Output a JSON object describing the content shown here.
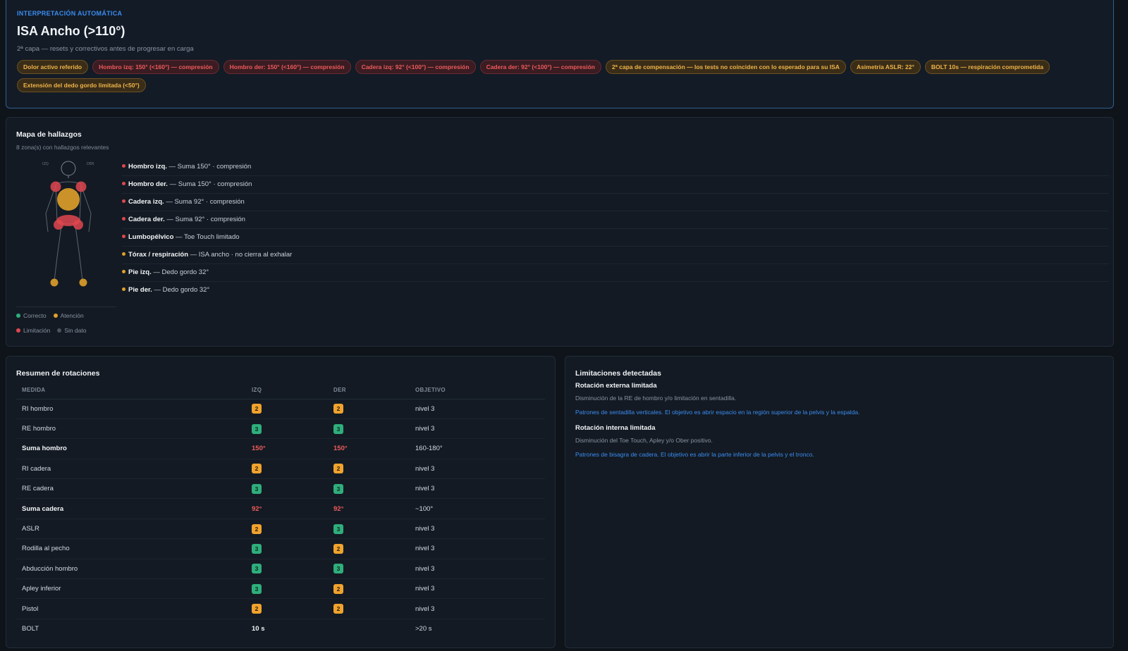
{
  "header": {
    "kicker": "INTERPRETACIÓN AUTOMÁTICA",
    "title": "ISA Ancho (>110°)",
    "subtitle": "2ª capa — resets y correctivos antes de progresar en carga",
    "chips": [
      {
        "text": "Dolor activo referido",
        "tone": "amber"
      },
      {
        "text": "Hombro izq: 150° (<160°) — compresión",
        "tone": "red"
      },
      {
        "text": "Hombro der: 150° (<160°) — compresión",
        "tone": "red"
      },
      {
        "text": "Cadera izq: 92° (<100°) — compresión",
        "tone": "red"
      },
      {
        "text": "Cadera der: 92° (<100°) — compresión",
        "tone": "red"
      },
      {
        "text": "2ª capa de compensación — los tests no coinciden con lo esperado para su ISA",
        "tone": "amber"
      },
      {
        "text": "Asimetría ASLR: 22°",
        "tone": "amber"
      },
      {
        "text": "BOLT 10s — respiración comprometida",
        "tone": "amber"
      },
      {
        "text": "Extensión del dedo gordo limitada (<50°)",
        "tone": "amber"
      }
    ]
  },
  "map": {
    "title": "Mapa de hallazgos",
    "subtitle": "8 zona(s) con hallazgos relevantes",
    "fig_left_label": "IZQ",
    "fig_right_label": "DER",
    "findings": [
      {
        "zone": "Hombro izq.",
        "detail": " — Suma 150° · compresión",
        "tone": "red"
      },
      {
        "zone": "Hombro der.",
        "detail": " — Suma 150° · compresión",
        "tone": "red"
      },
      {
        "zone": "Cadera izq.",
        "detail": " — Suma 92° · compresión",
        "tone": "red"
      },
      {
        "zone": "Cadera der.",
        "detail": " — Suma 92° · compresión",
        "tone": "red"
      },
      {
        "zone": "Lumbopélvico",
        "detail": " — Toe Touch limitado",
        "tone": "red"
      },
      {
        "zone": "Tórax / respiración",
        "detail": " — ISA ancho · no cierra al exhalar",
        "tone": "amber"
      },
      {
        "zone": "Pie izq.",
        "detail": " — Dedo gordo 32°",
        "tone": "amber"
      },
      {
        "zone": "Pie der.",
        "detail": " — Dedo gordo 32°",
        "tone": "amber"
      }
    ],
    "legend": {
      "ok": "Correcto",
      "attention": "Atención",
      "limit": "Limitación",
      "nodata": "Sin dato"
    }
  },
  "rotations": {
    "title": "Resumen de rotaciones",
    "headers": {
      "measure": "MEDIDA",
      "left": "IZQ",
      "right": "DER",
      "target": "OBJETIVO"
    },
    "rows": [
      {
        "measure": "RI hombro",
        "left": "2",
        "right": "2",
        "target": "nivel 3",
        "kind": "badge"
      },
      {
        "measure": "RE hombro",
        "left": "3",
        "right": "3",
        "target": "nivel 3",
        "kind": "badge"
      },
      {
        "measure": "Suma hombro",
        "left": "150°",
        "right": "150°",
        "target": "160-180°",
        "kind": "sum"
      },
      {
        "measure": "RI cadera",
        "left": "2",
        "right": "2",
        "target": "nivel 3",
        "kind": "badge"
      },
      {
        "measure": "RE cadera",
        "left": "3",
        "right": "3",
        "target": "nivel 3",
        "kind": "badge"
      },
      {
        "measure": "Suma cadera",
        "left": "92°",
        "right": "92°",
        "target": "~100°",
        "kind": "sum"
      },
      {
        "measure": "ASLR",
        "left": "2",
        "right": "3",
        "target": "nivel 3",
        "kind": "badge"
      },
      {
        "measure": "Rodilla al pecho",
        "left": "3",
        "right": "2",
        "target": "nivel 3",
        "kind": "badge"
      },
      {
        "measure": "Abducción hombro",
        "left": "3",
        "right": "3",
        "target": "nivel 3",
        "kind": "badge"
      },
      {
        "measure": "Apley inferior",
        "left": "3",
        "right": "2",
        "target": "nivel 3",
        "kind": "badge"
      },
      {
        "measure": "Pistol",
        "left": "2",
        "right": "2",
        "target": "nivel 3",
        "kind": "badge"
      },
      {
        "measure": "BOLT",
        "left": "10 s",
        "right": "",
        "target": ">20 s",
        "kind": "plain"
      }
    ]
  },
  "limitations": {
    "title": "Limitaciones detectadas",
    "items": [
      {
        "title": "Rotación externa limitada",
        "desc": "Disminución de la RE de hombro y/o limitación en sentadilla.",
        "link": "Patrones de sentadilla verticales. El objetivo es abrir espacio en la región superior de la pelvis y la espalda."
      },
      {
        "title": "Rotación interna limitada",
        "desc": "Disminución del Toe Touch, Apley y/o Ober positivo.",
        "link": "Patrones de bisagra de cadera. El objetivo es abrir la parte inferior de la pelvis y el tronco."
      }
    ]
  },
  "colors": {
    "red": "#e0474f",
    "amber": "#e0a02a",
    "green": "#2fae7c",
    "gray": "#4a5360",
    "accent": "#3b8cf0"
  }
}
